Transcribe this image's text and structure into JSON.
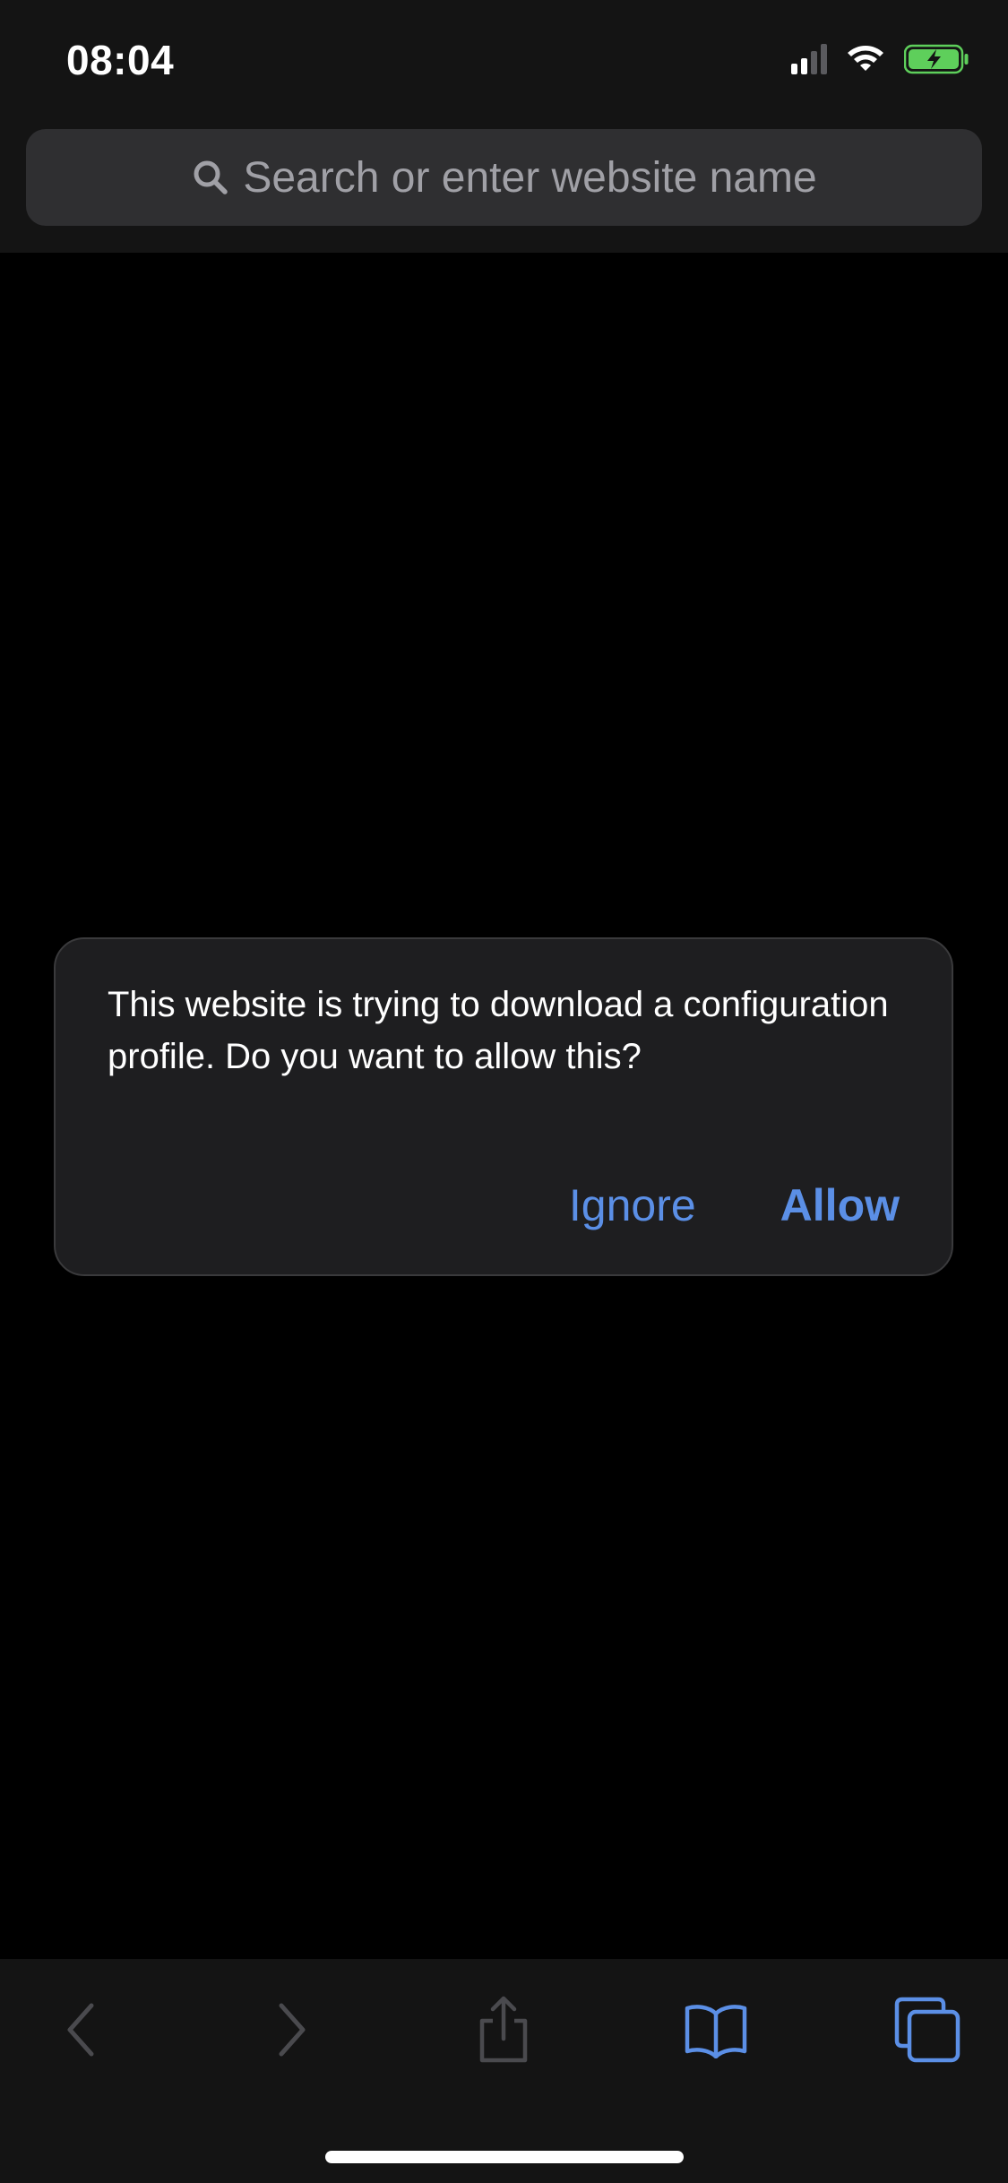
{
  "status_bar": {
    "time": "08:04",
    "icons": [
      "cellular-signal-icon",
      "wifi-icon",
      "battery-charging-icon"
    ],
    "battery_color": "#5ecf5b"
  },
  "address_bar": {
    "placeholder": "Search or enter website name",
    "icon": "search-icon"
  },
  "dialog": {
    "message": "This website is trying to download a configuration profile. Do you want to allow this?",
    "ignore_label": "Ignore",
    "allow_label": "Allow",
    "accent_color": "#5b8fe6"
  },
  "toolbar": {
    "items": [
      {
        "icon": "back-chevron-icon",
        "enabled": false
      },
      {
        "icon": "forward-chevron-icon",
        "enabled": false
      },
      {
        "icon": "share-icon",
        "enabled": false
      },
      {
        "icon": "bookmarks-icon",
        "enabled": true
      },
      {
        "icon": "tabs-icon",
        "enabled": true
      }
    ]
  },
  "colors": {
    "background": "#000000",
    "bar_background": "#141414",
    "dialog_background": "#1e1e20",
    "disabled_icon": "#4a4a4e",
    "active_icon": "#5b8fe6"
  }
}
